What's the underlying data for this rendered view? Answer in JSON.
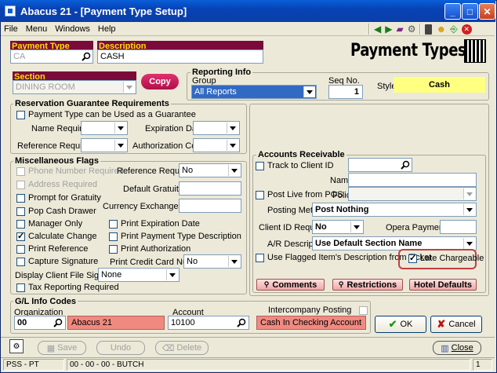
{
  "window": {
    "title": "Abacus 21 - [Payment Type Setup]"
  },
  "menu": [
    "File",
    "Menu",
    "Windows",
    "Help"
  ],
  "header": {
    "payment_type_code_label": "Payment Type Code",
    "payment_type_code": "CA",
    "description_label": "Description",
    "description": "CASH",
    "big_title": "Payment Types"
  },
  "section": {
    "label": "Section",
    "value": "DINING ROOM",
    "copy_label": "Copy"
  },
  "reporting": {
    "legend": "Reporting Info",
    "group_label": "Group",
    "group_value": "All Reports",
    "seq_label": "Seq No.",
    "seq_value": "1",
    "style_label": "Style",
    "style_value": "Cash"
  },
  "reservation": {
    "legend": "Reservation Guarantee Requirements",
    "guarantee_label": "Payment Type can be Used as a Guarantee",
    "name_required_label": "Name Required",
    "expiration_date_label": "Expiration Date",
    "reference_required_label": "Reference Required",
    "authorization_code_label": "Authorization Code"
  },
  "misc": {
    "legend": "Miscellaneous Flags",
    "phone_number_required": "Phone Number Required",
    "address_required": "Address Required",
    "prompt_for_gratuity": "Prompt for Gratuity",
    "pop_cash_drawer": "Pop Cash Drawer",
    "manager_only": "Manager Only",
    "calculate_change": "Calculate Change",
    "print_reference": "Print Reference",
    "capture_signature": "Capture Signature",
    "display_client_file_signature": "Display Client File Signature",
    "display_client_file_signature_value": "None",
    "tax_reporting_required": "Tax Reporting Required",
    "reference_required_label": "Reference Required",
    "reference_required_value": "No",
    "default_gratuity_label": "Default Gratuity %",
    "currency_exchange_rate_label": "Currency Exchange Rate",
    "print_expiration_date": "Print Expiration Date",
    "print_payment_type_description": "Print Payment Type Description",
    "print_authorization": "Print Authorization",
    "print_credit_card_number_label": "Print Credit Card Number",
    "print_credit_card_number_value": "No"
  },
  "ar": {
    "legend": "Accounts Receivable",
    "track_to_client_id": "Track to Client ID",
    "name_label": "Name",
    "post_live_from_pos": "Post Live from POS",
    "folio_label": "Folio",
    "posting_method_label": "Posting Method",
    "posting_method_value": "Post Nothing",
    "client_id_required_label": "Client ID Required",
    "client_id_required_value": "No",
    "opera_payment_label": "Opera Payment #",
    "ar_description_label": "A/R Description",
    "ar_description_value": "Use Default Section Name",
    "use_flagged_label": "Use Flagged Item's Description from Ticket",
    "late_chargeable_label": "Late Chargeable",
    "comments_label": "Comments",
    "restrictions_label": "Restrictions",
    "hotel_defaults_label": "Hotel Defaults"
  },
  "gl": {
    "legend": "G/L Info Codes",
    "organization_label": "Organization",
    "organization_code": "00",
    "organization_name": "Abacus 21",
    "account_label": "Account",
    "account_code": "10100",
    "account_name": "Cash In Checking Account",
    "intercompany_label": "Intercompany Posting"
  },
  "buttons": {
    "ok": "OK",
    "cancel": "Cancel",
    "save": "Save",
    "undo": "Undo",
    "delete": "Delete",
    "close": "Close"
  },
  "status": {
    "left": "PSS - PT",
    "middle": "00 - 00 - 00 - BUTCH",
    "right": "1"
  }
}
